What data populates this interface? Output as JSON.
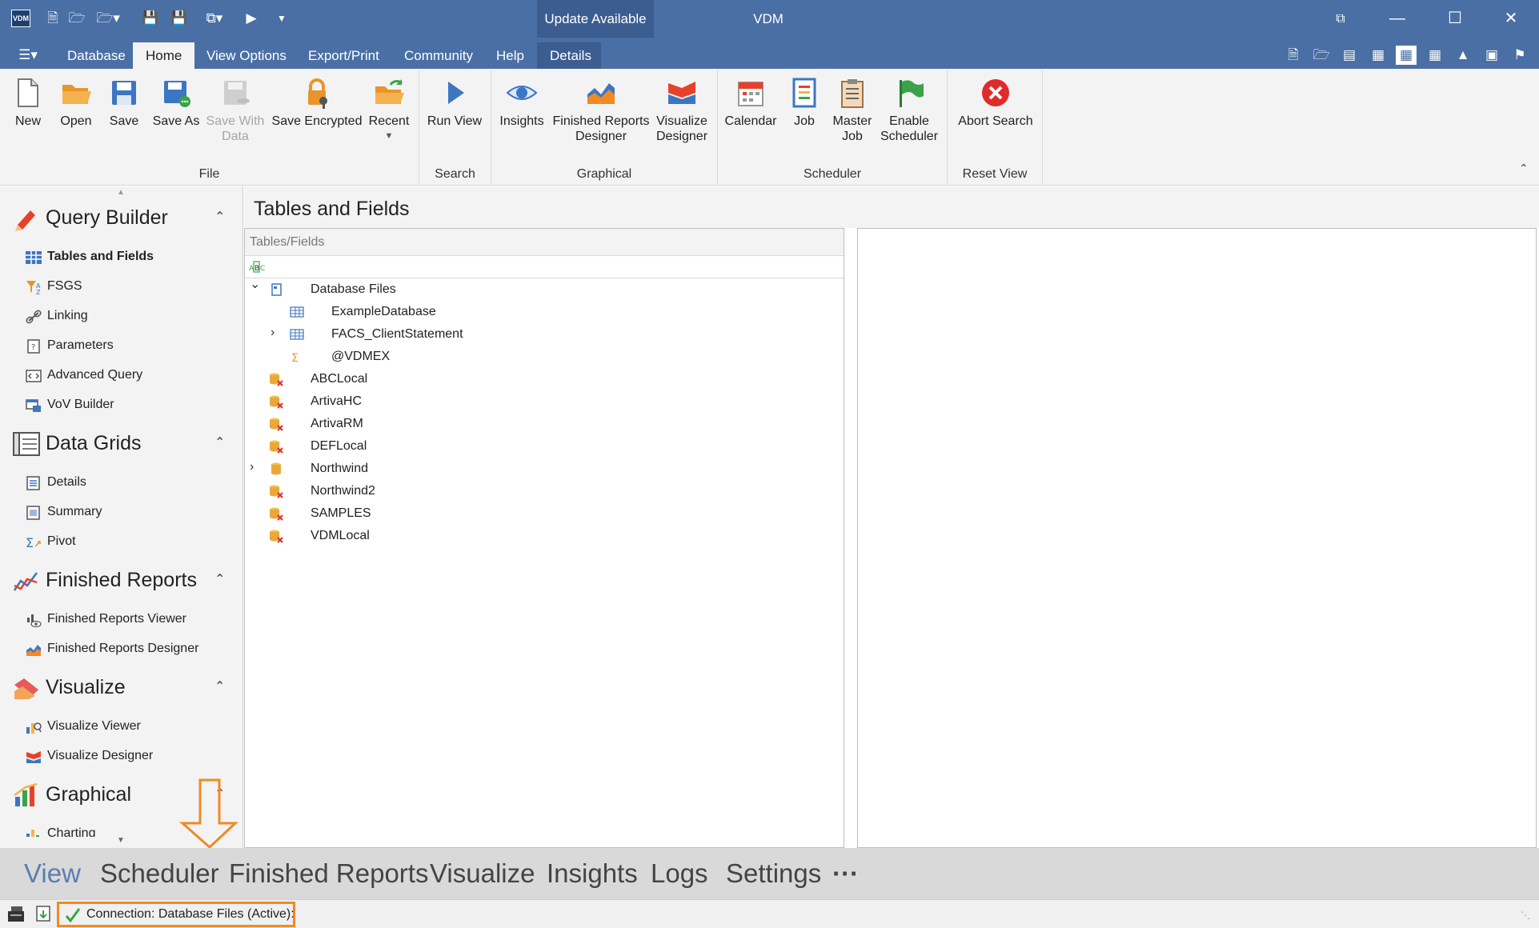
{
  "titlebar": {
    "logo": "VDM",
    "update": "Update Available",
    "title": "VDM",
    "quick_access_icons": [
      "new-file-icon",
      "open-folder-icon",
      "open-menu-icon",
      "save-icon",
      "save-all-icon",
      "export-icon",
      "run-icon",
      "customize-icon"
    ]
  },
  "tabs": {
    "menu_icon": "app-menu-icon",
    "items": [
      {
        "label": "Database"
      },
      {
        "label": "Home"
      },
      {
        "label": "View Options"
      },
      {
        "label": "Export/Print"
      },
      {
        "label": "Community"
      },
      {
        "label": "Help"
      },
      {
        "label": "Details"
      }
    ],
    "active": "Home"
  },
  "ribbon": {
    "buttons": {
      "new": "New",
      "open": "Open",
      "save": "Save",
      "save_as": "Save As",
      "save_with_data": "Save With Data",
      "save_encrypted": "Save Encrypted",
      "recent": "Recent",
      "run_view": "Run View",
      "insights": "Insights",
      "finished_reports_designer": "Finished Reports Designer",
      "visualize_designer": "Visualize Designer",
      "calendar": "Calendar",
      "job": "Job",
      "master_job": "Master Job",
      "enable_scheduler": "Enable Scheduler",
      "abort_search": "Abort Search"
    },
    "groups": {
      "file": "File",
      "search": "Search",
      "graphical": "Graphical",
      "scheduler": "Scheduler",
      "reset_view": "Reset View"
    }
  },
  "leftnav": {
    "sections": {
      "query_builder": "Query Builder",
      "data_grids": "Data Grids",
      "finished_reports": "Finished Reports",
      "visualize": "Visualize",
      "graphical": "Graphical"
    },
    "items": {
      "tables_and_fields": "Tables and Fields",
      "fsgs": "FSGS",
      "linking": "Linking",
      "parameters": "Parameters",
      "advanced_query": "Advanced Query",
      "vov_builder": "VoV Builder",
      "details": "Details",
      "summary": "Summary",
      "pivot": "Pivot",
      "finished_reports_viewer": "Finished Reports Viewer",
      "finished_reports_designer": "Finished Reports Designer",
      "visualize_viewer": "Visualize Viewer",
      "visualize_designer": "Visualize Designer",
      "charting": "Charting"
    }
  },
  "main": {
    "title": "Tables and Fields",
    "tree_header": "Tables/Fields",
    "tree": [
      {
        "label": "Database Files",
        "level": 0,
        "expander": "expanded",
        "icon": "database-file-icon"
      },
      {
        "label": "ExampleDatabase",
        "level": 1,
        "expander": "none",
        "icon": "table-icon"
      },
      {
        "label": "FACS_ClientStatement",
        "level": 1,
        "expander": "collapsed",
        "icon": "table-icon"
      },
      {
        "label": "@VDMEX",
        "level": 1,
        "expander": "none",
        "icon": "sigma-icon"
      },
      {
        "label": "ABCLocal",
        "level": 0,
        "expander": "none",
        "icon": "database-error-icon"
      },
      {
        "label": "ArtivaHC",
        "level": 0,
        "expander": "none",
        "icon": "database-error-icon"
      },
      {
        "label": "ArtivaRM",
        "level": 0,
        "expander": "none",
        "icon": "database-error-icon"
      },
      {
        "label": "DEFLocal",
        "level": 0,
        "expander": "none",
        "icon": "database-error-icon"
      },
      {
        "label": "Northwind",
        "level": 0,
        "expander": "collapsed",
        "icon": "database-icon"
      },
      {
        "label": "Northwind2",
        "level": 0,
        "expander": "none",
        "icon": "database-error-icon"
      },
      {
        "label": "SAMPLES",
        "level": 0,
        "expander": "none",
        "icon": "database-error-icon"
      },
      {
        "label": "VDMLocal",
        "level": 0,
        "expander": "none",
        "icon": "database-error-icon"
      }
    ]
  },
  "bottomnav": {
    "items": [
      "View",
      "Scheduler",
      "Finished Reports",
      "Visualize",
      "Insights",
      "Logs",
      "Settings",
      "···"
    ],
    "active": "View"
  },
  "status": {
    "connection": "Connection: Database Files (Active):"
  },
  "colors": {
    "titlebar": "#4a6fa5",
    "highlight": "#f08a24"
  }
}
